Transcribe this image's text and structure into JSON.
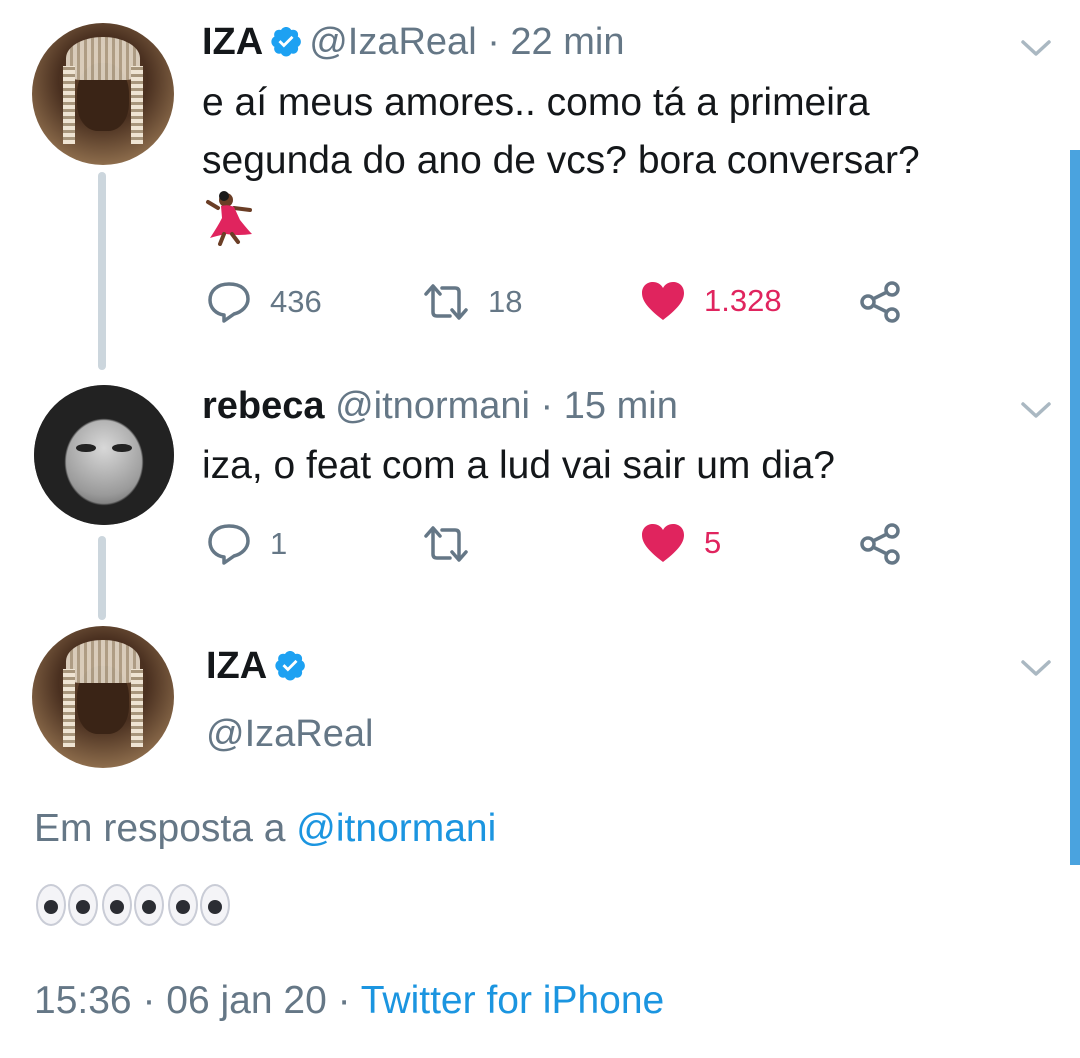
{
  "tweets": [
    {
      "name": "IZA",
      "handle": "@IzaReal",
      "sep": "·",
      "time": "22 min",
      "text_line1": "e aí meus amores.. como tá a primeira",
      "text_line2": "segunda do ano de vcs? bora conversar?",
      "emoji": "woman-dancing-emoji",
      "replies": "436",
      "retweets": "18",
      "likes": "1.328"
    },
    {
      "name": "rebeca",
      "handle": "@itnormani",
      "sep": "·",
      "time": "15 min",
      "text_line1": "iza, o feat com a lud vai sair um dia?",
      "replies": "1",
      "retweets": "",
      "likes": "5"
    }
  ],
  "focused": {
    "name": "IZA",
    "handle": "@IzaReal",
    "reply_prefix": "Em resposta a",
    "reply_mention": "@itnormani",
    "content_emoji": "eyes-emoji ×3",
    "time": "15:36",
    "sep1": "·",
    "date": "06 jan 20",
    "sep2": "·",
    "source": "Twitter for iPhone"
  },
  "colors": {
    "accent": "#1b95e0",
    "like": "#e0245e",
    "muted": "#657786",
    "thread_line": "#ccd6dd",
    "scrollbar": "#4aa3df"
  }
}
